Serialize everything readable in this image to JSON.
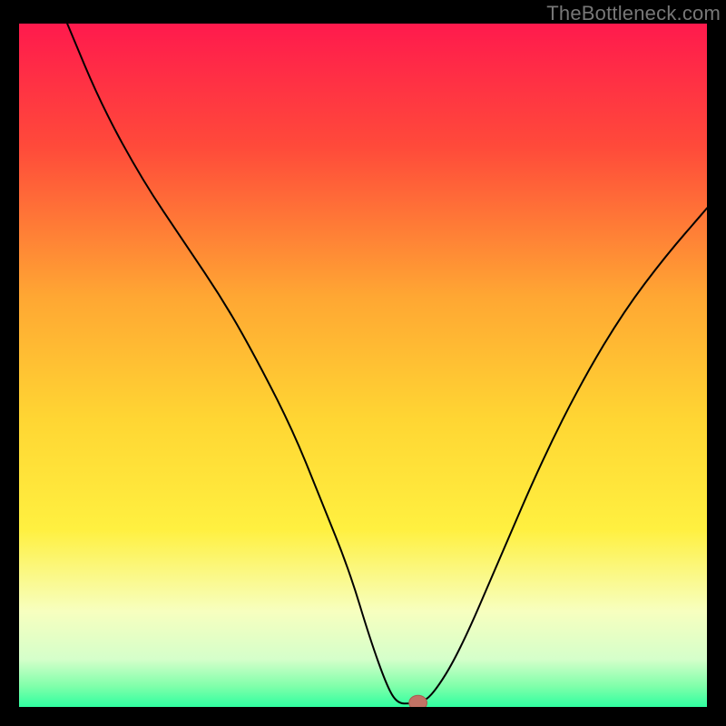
{
  "attribution": "TheBottleneck.com",
  "colors": {
    "marker_fill": "#c17365",
    "marker_stroke": "#a85a4d",
    "curve_stroke": "#000000",
    "frame_bg": "#000000"
  },
  "gradient_stops": [
    {
      "offset": 0.0,
      "color": "#ff1a4d"
    },
    {
      "offset": 0.18,
      "color": "#ff4a3a"
    },
    {
      "offset": 0.4,
      "color": "#ffa733"
    },
    {
      "offset": 0.58,
      "color": "#ffd633"
    },
    {
      "offset": 0.74,
      "color": "#fff040"
    },
    {
      "offset": 0.86,
      "color": "#f7ffbf"
    },
    {
      "offset": 0.93,
      "color": "#d5ffca"
    },
    {
      "offset": 0.97,
      "color": "#7fffaa"
    },
    {
      "offset": 1.0,
      "color": "#2fffa0"
    }
  ],
  "chart_data": {
    "type": "line",
    "title": "",
    "xlabel": "",
    "ylabel": "",
    "xlim": [
      0,
      100
    ],
    "ylim": [
      0,
      100
    ],
    "legend": false,
    "grid": false,
    "series": [
      {
        "name": "curve",
        "x": [
          7,
          12,
          18,
          24,
          30,
          35,
          40,
          44,
          48,
          51,
          53.5,
          55,
          57,
          58,
          60,
          64,
          70,
          76,
          82,
          88,
          94,
          100
        ],
        "y": [
          100,
          88,
          77,
          68,
          59,
          50,
          40,
          30,
          20,
          10,
          3,
          0.5,
          0.5,
          0.6,
          1.5,
          8,
          22,
          36,
          48,
          58,
          66,
          73
        ]
      }
    ],
    "marker": {
      "x": 58,
      "y": 0.6,
      "rx": 1.3,
      "ry": 1.1
    },
    "notes": "y represents bottleneck percentage (0 at bottom, 100 at top); x is a configuration parameter axis with no visible ticks or labels; values are estimated from the rendered curve."
  }
}
